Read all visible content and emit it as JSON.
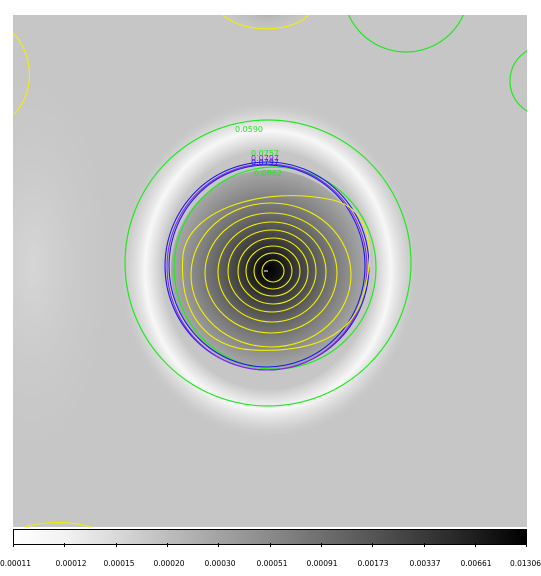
{
  "viewer": {
    "contour_labels": {
      "outer": "0.0590",
      "blue_a": "0.0757",
      "blue_b": "0.0797",
      "inner": "0.0862"
    }
  },
  "colorbar": {
    "ticks": [
      "0.00011",
      "0.00012",
      "0.00015",
      "0.00020",
      "0.00030",
      "0.00051",
      "0.00091",
      "0.00173",
      "0.00337",
      "0.00661",
      "0.01306"
    ]
  },
  "colors": {
    "green_contour": "#22e822",
    "yellow_contour": "#f0f000",
    "blue_contour": "#1a1aee",
    "purple_contour": "#8a2be2",
    "background": "#c6c6c6"
  }
}
